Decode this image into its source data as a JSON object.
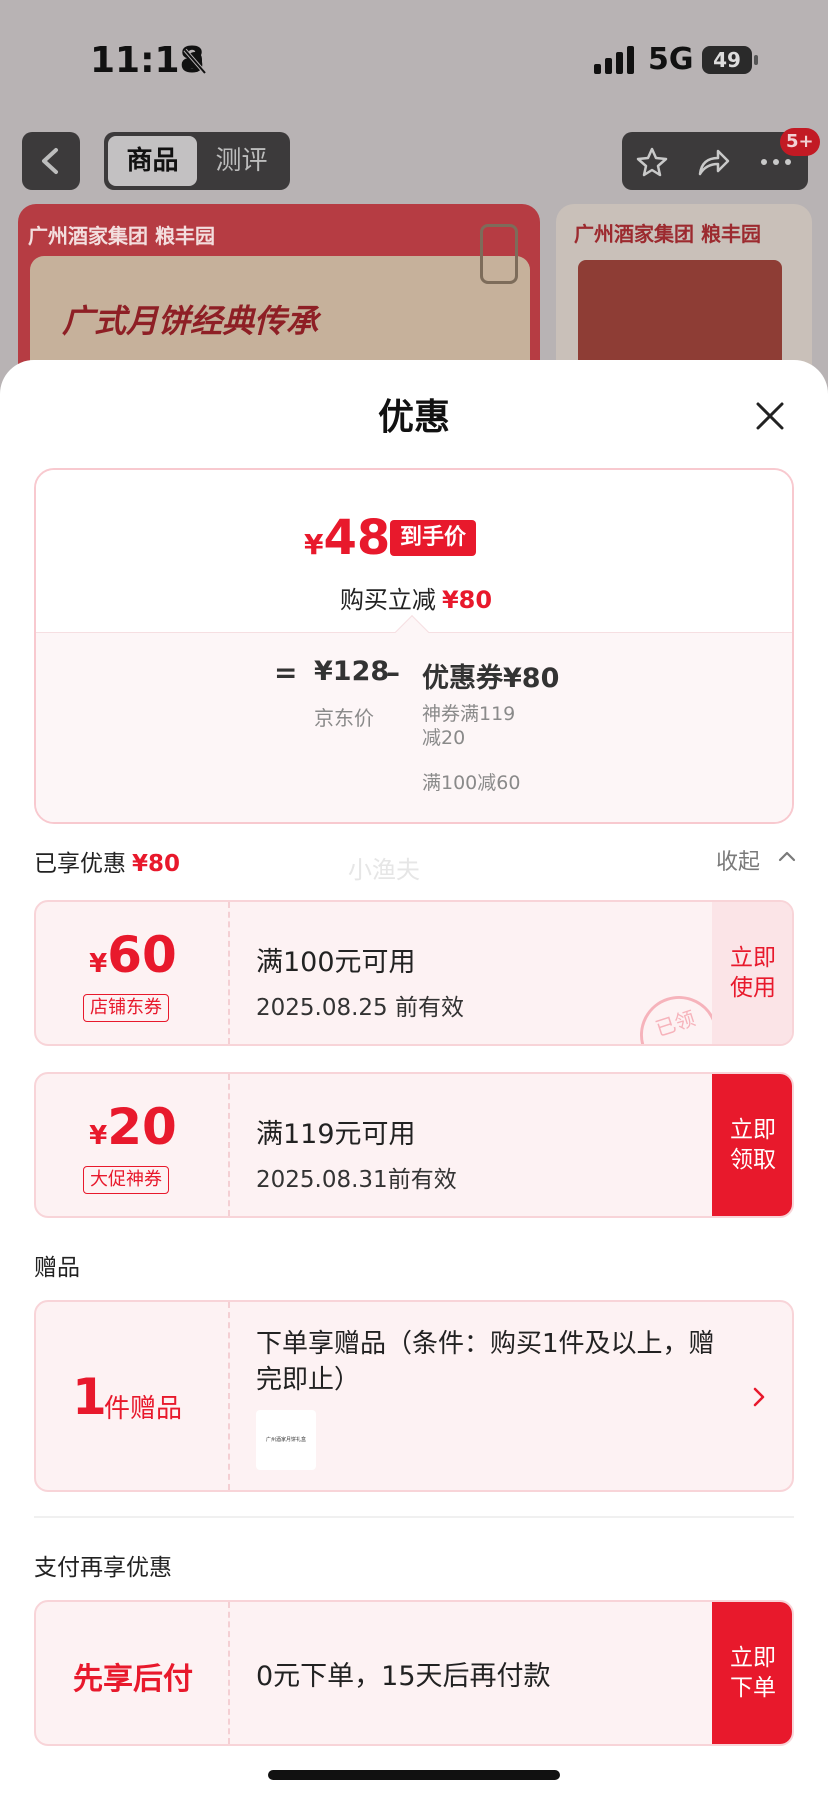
{
  "status_bar": {
    "time": "11:18",
    "network": "5G",
    "battery": "49"
  },
  "product_nav": {
    "tabs": [
      {
        "label": "商品",
        "active": true
      },
      {
        "label": "测评",
        "active": false
      }
    ],
    "badge": "5+"
  },
  "banners": {
    "left_brand": "广州酒家集团 粮丰园",
    "left_slogan": "广式月饼经典传承",
    "right_brand": "广州酒家集团 粮丰园"
  },
  "sheet": {
    "title": "优惠",
    "summary": {
      "currency": "¥",
      "final_price": "48",
      "final_tag": "到手价",
      "reduce_label": "购买立减",
      "reduce_amount": "¥80",
      "equals": "=",
      "jd_price": "¥128",
      "jd_label": "京东价",
      "minus": "–",
      "coupon_total": "优惠券¥80",
      "coupon_detail_1": "神券满119减20",
      "coupon_detail_2": "满100减60"
    },
    "enjoyed": {
      "label": "已享优惠",
      "amount": "¥80",
      "collapse_label": "收起"
    },
    "watermark": "小渔夫",
    "coupons": [
      {
        "currency": "¥",
        "amount": "60",
        "type": "店铺东券",
        "condition": "满100元可用",
        "validity": "2025.08.25 前有效",
        "cta_line1": "立即",
        "cta_line2": "使用",
        "stamp": "已领"
      },
      {
        "currency": "¥",
        "amount": "20",
        "type": "大促神券",
        "condition": "满119元可用",
        "validity": "2025.08.31前有效",
        "cta_line1": "立即",
        "cta_line2": "领取"
      }
    ],
    "gift": {
      "section_label": "赠品",
      "count": "1",
      "unit": "件赠品",
      "description": "下单享赠品（条件：购买1件及以上，赠完即止）",
      "thumb_text": "广州酒家月饼礼盒"
    },
    "pay": {
      "section_label": "支付再享优惠",
      "name": "先享后付",
      "text": "0元下单，15天后再付款",
      "cta_line1": "立即",
      "cta_line2": "下单"
    }
  },
  "colors": {
    "accent": "#e8192c",
    "coupon_bg": "#fdf2f3",
    "border": "#f8d4d8"
  },
  "icons": [
    "bell-off-icon",
    "signal-icon",
    "back-icon",
    "star-icon",
    "share-icon",
    "more-icon",
    "close-icon",
    "chevron-up-icon",
    "chevron-right-icon"
  ]
}
